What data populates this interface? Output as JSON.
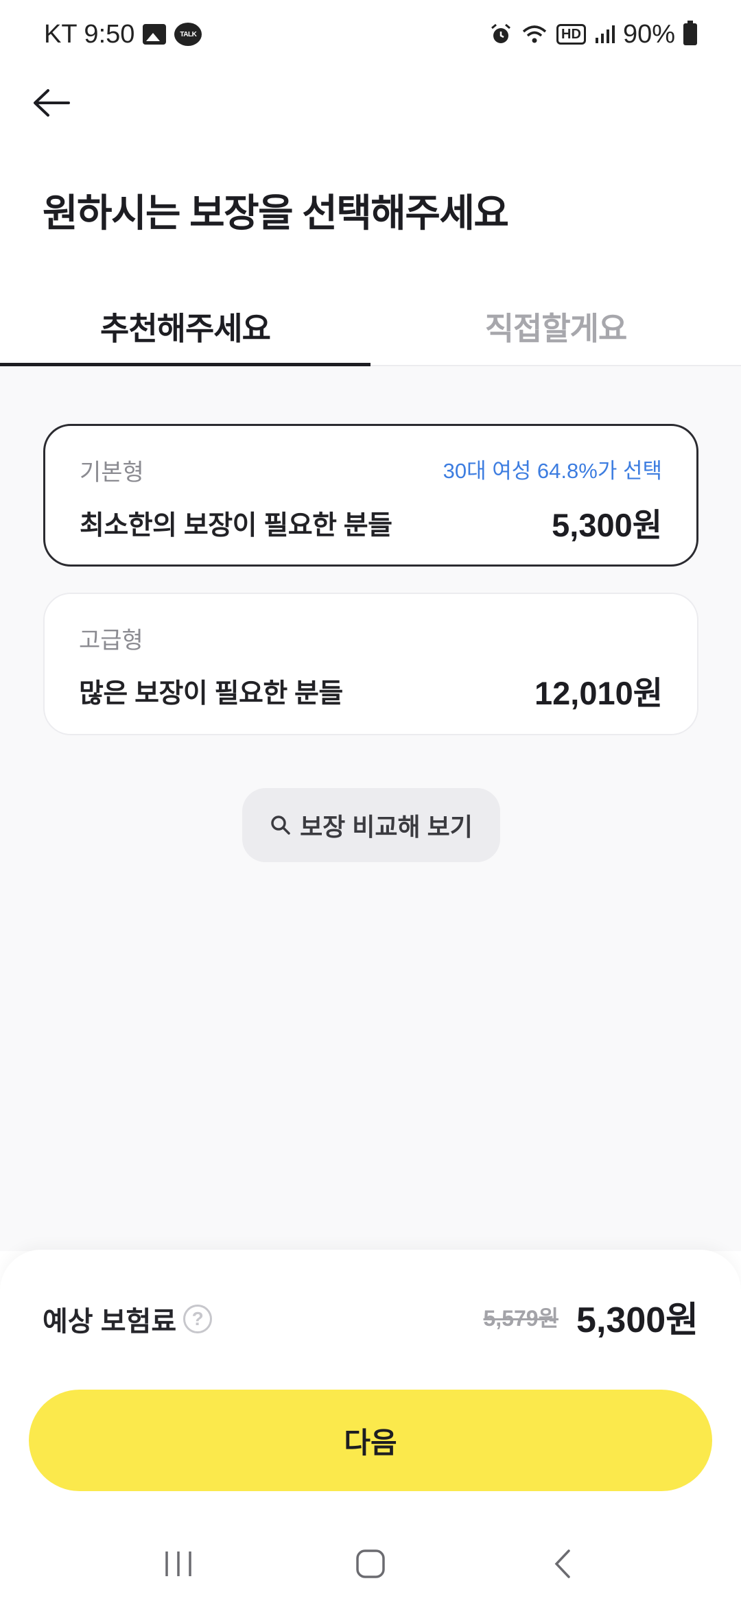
{
  "status_bar": {
    "carrier_time": "KT 9:50",
    "talk_label": "TALK",
    "hd_label": "HD",
    "battery": "90%"
  },
  "page": {
    "title": "원하시는 보장을 선택해주세요"
  },
  "tabs": [
    {
      "label": "추천해주세요",
      "active": true
    },
    {
      "label": "직접할게요",
      "active": false
    }
  ],
  "plans": [
    {
      "type": "기본형",
      "badge": "30대 여성 64.8%가 선택",
      "description": "최소한의 보장이 필요한 분들",
      "price": "5,300원",
      "selected": true
    },
    {
      "type": "고급형",
      "badge": "",
      "description": "많은 보장이 필요한 분들",
      "price": "12,010원",
      "selected": false
    }
  ],
  "compare_button": {
    "label": "보장 비교해 보기",
    "icon": "search-icon"
  },
  "summary": {
    "label": "예상 보험료",
    "help_icon": "?",
    "original_price": "5,579원",
    "final_price": "5,300원"
  },
  "next_button": {
    "label": "다음"
  },
  "colors": {
    "accent_yellow": "#fbe94c",
    "badge_blue": "#3d7de0",
    "selected_border": "#2b2b30"
  }
}
